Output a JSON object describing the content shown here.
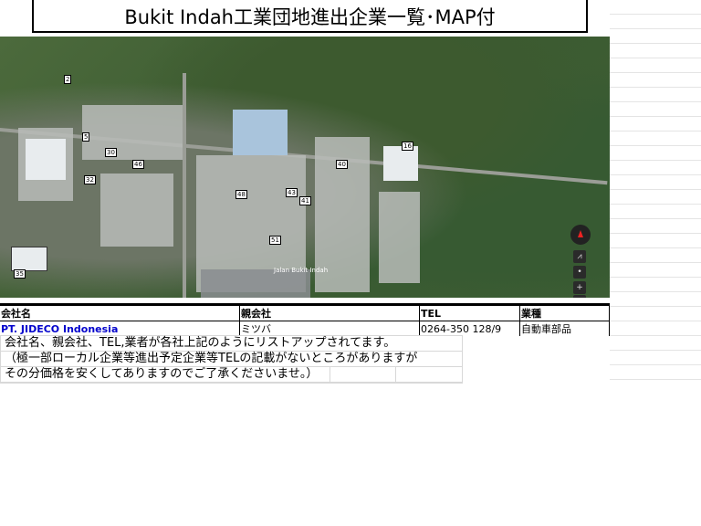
{
  "title": "Bukit Indah工業団地進出企業一覧･MAP付",
  "map": {
    "labels": [
      "2",
      "5",
      "16",
      "30",
      "32",
      "35",
      "40",
      "41",
      "43",
      "46",
      "48",
      "51"
    ],
    "road_label": "Jalan Bukit Indah",
    "controls": [
      "compass-icon",
      "tilt-icon",
      "center-icon",
      "zoom-in-icon",
      "zoom-out-icon"
    ]
  },
  "table": {
    "headers": [
      "会社名",
      "親会社",
      "TEL",
      "業種"
    ],
    "rows": [
      [
        "PT. JIDECO Indonesia",
        "ミツバ",
        "0264-350 128/9",
        "自動車部品"
      ]
    ]
  },
  "note": [
    "会社名、親会社、TEL,業者が各社上記のようにリストアップされてます。",
    "（極一部ローカル企業等進出予定企業等TELの記載がないところがありますが",
    "その分価格を安くしてありますのでご了承くださいませ。）"
  ]
}
